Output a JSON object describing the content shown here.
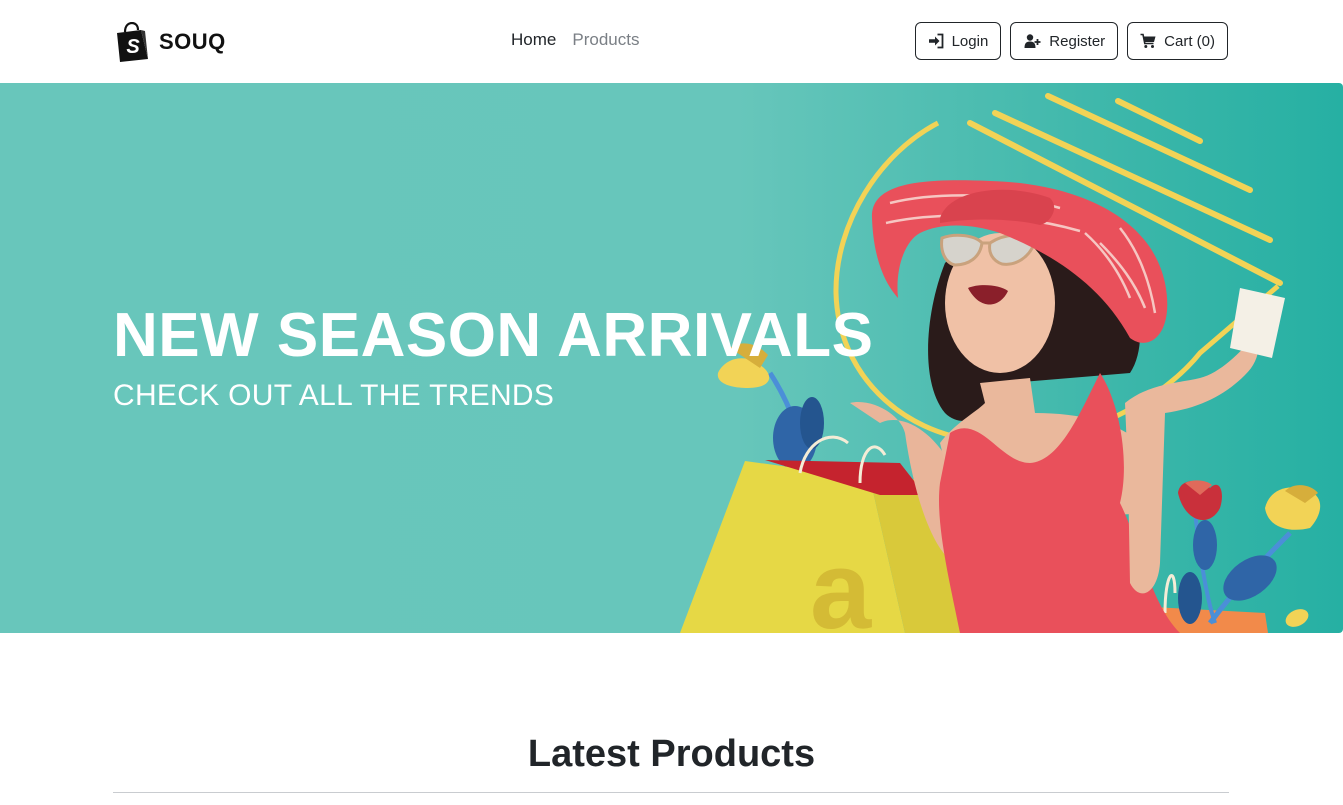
{
  "brand": {
    "name": "SOUQ",
    "icon": "shopping-bag-logo-icon"
  },
  "nav": {
    "links": [
      {
        "label": "Home",
        "active": true
      },
      {
        "label": "Products",
        "active": false
      }
    ]
  },
  "actions": {
    "login": {
      "label": "Login",
      "icon": "sign-in-icon"
    },
    "register": {
      "label": "Register",
      "icon": "user-plus-icon"
    },
    "cart": {
      "label": "Cart (0)",
      "icon": "shopping-cart-icon"
    }
  },
  "hero": {
    "title": "NEW SEASON ARRIVALS",
    "subtitle": "CHECK OUT ALL THE TRENDS",
    "image": "woman-with-shopping-bags",
    "colors": {
      "background": "#67c6bb",
      "accent_yellow": "#f2d356",
      "dress_red": "#e9505b"
    }
  },
  "products": {
    "heading": "Latest Products"
  }
}
